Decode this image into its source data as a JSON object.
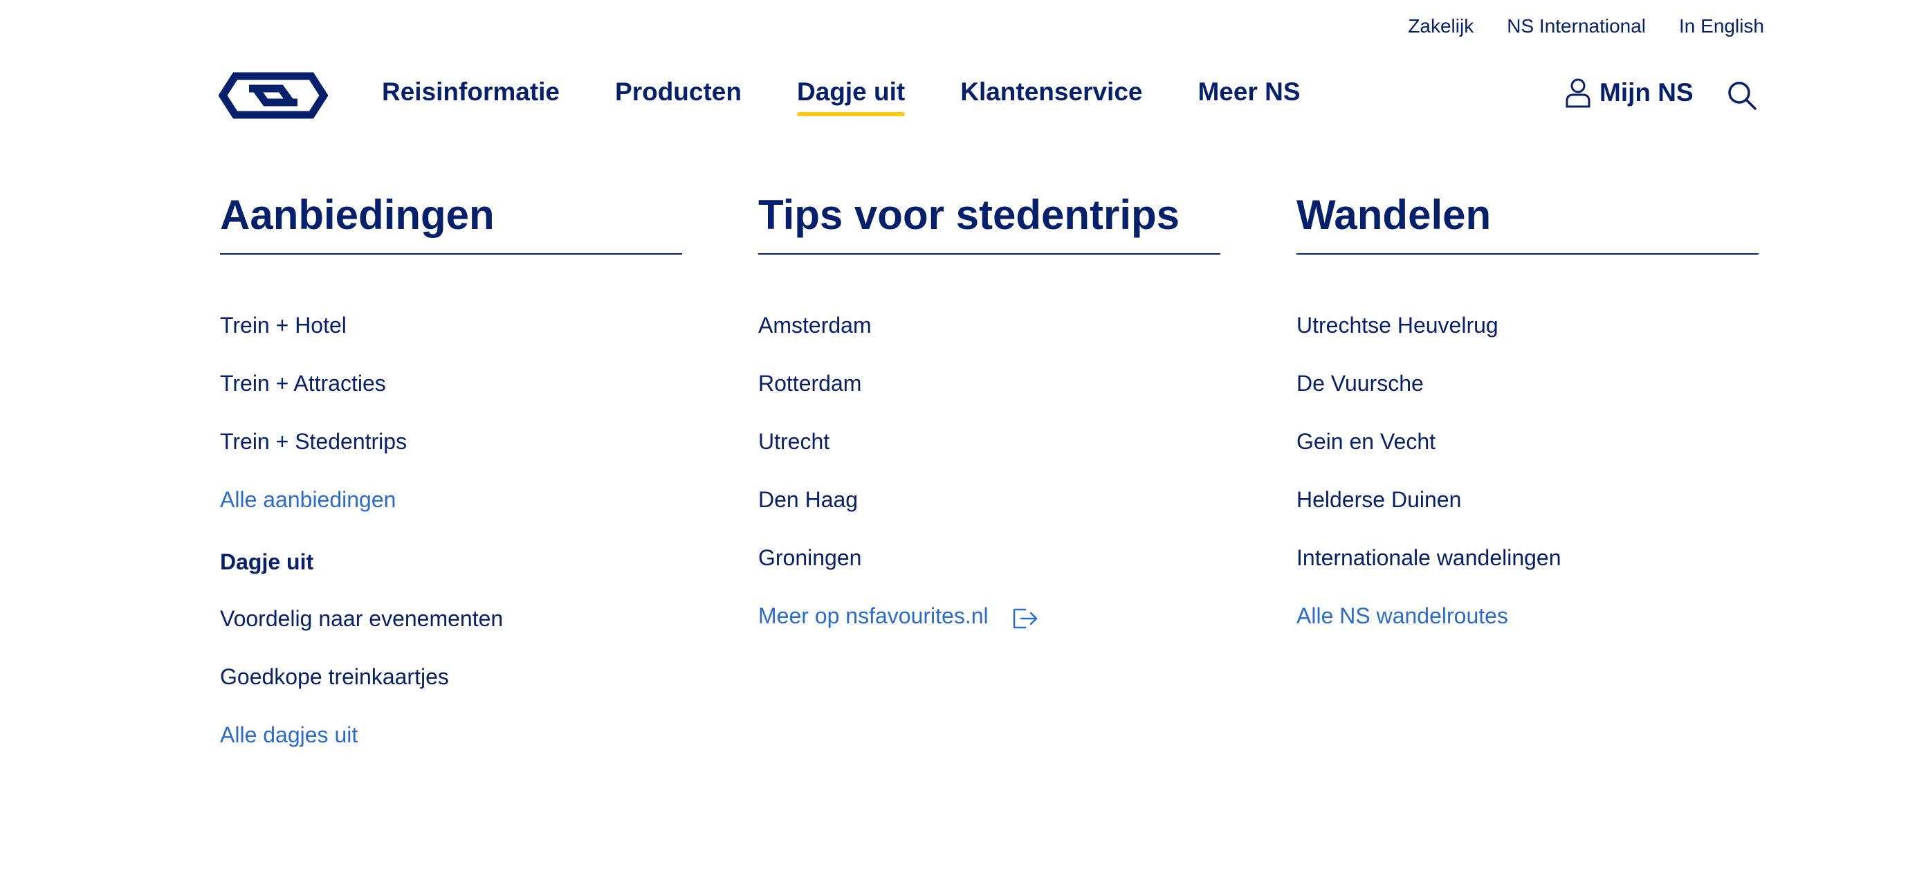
{
  "topbar": {
    "zakelijk": "Zakelijk",
    "international": "NS International",
    "english": "In English"
  },
  "nav": {
    "items": [
      "Reisinformatie",
      "Producten",
      "Dagje uit",
      "Klantenservice",
      "Meer NS"
    ],
    "active": "Dagje uit",
    "mijn_ns": "Mijn NS"
  },
  "colors": {
    "brand_blue": "#07206b",
    "link_blue": "#2a6bd1",
    "accent_yellow": "#ffc917"
  },
  "columns": {
    "aanbiedingen": {
      "title": "Aanbiedingen",
      "items": [
        "Trein + Hotel",
        "Trein + Attracties",
        "Trein + Stedentrips"
      ],
      "more": "Alle aanbiedingen",
      "subheading": "Dagje uit",
      "sub_items": [
        "Voordelig naar evenementen",
        "Goedkope treinkaartjes"
      ],
      "sub_more": "Alle dagjes uit"
    },
    "tips": {
      "title": "Tips voor stedentrips",
      "items": [
        "Amsterdam",
        "Rotterdam",
        "Utrecht",
        "Den Haag",
        "Groningen"
      ],
      "more": "Meer op nsfavourites.nl",
      "more_icon": "external-link-icon"
    },
    "wandelen": {
      "title": "Wandelen",
      "items": [
        "Utrechtse Heuvelrug",
        "De Vuursche",
        "Gein en Vecht",
        "Helderse Duinen",
        "Internationale wandelingen"
      ],
      "more": "Alle NS wandelroutes"
    }
  }
}
